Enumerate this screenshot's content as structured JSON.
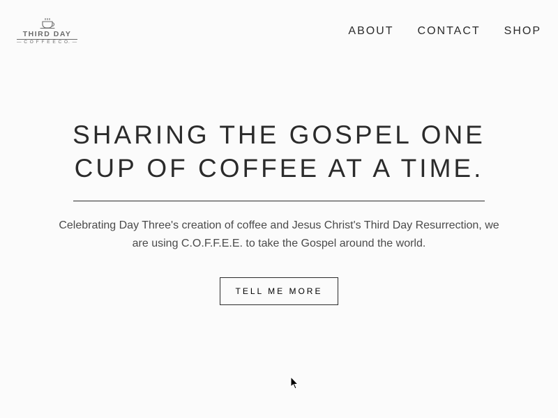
{
  "brand": {
    "line1": "THIRD DAY",
    "line2": "— C O F F E E  C O. —"
  },
  "nav": {
    "about": "ABOUT",
    "contact": "CONTACT",
    "shop": "SHOP"
  },
  "hero": {
    "headline": "SHARING THE GOSPEL ONE CUP OF COFFEE AT A TIME.",
    "tagline": "Celebrating Day Three's creation of coffee and Jesus Christ's Third Day Resurrection, we are using C.O.F.F.E.E. to take the Gospel around the world.",
    "cta_label": "TELL ME MORE"
  }
}
